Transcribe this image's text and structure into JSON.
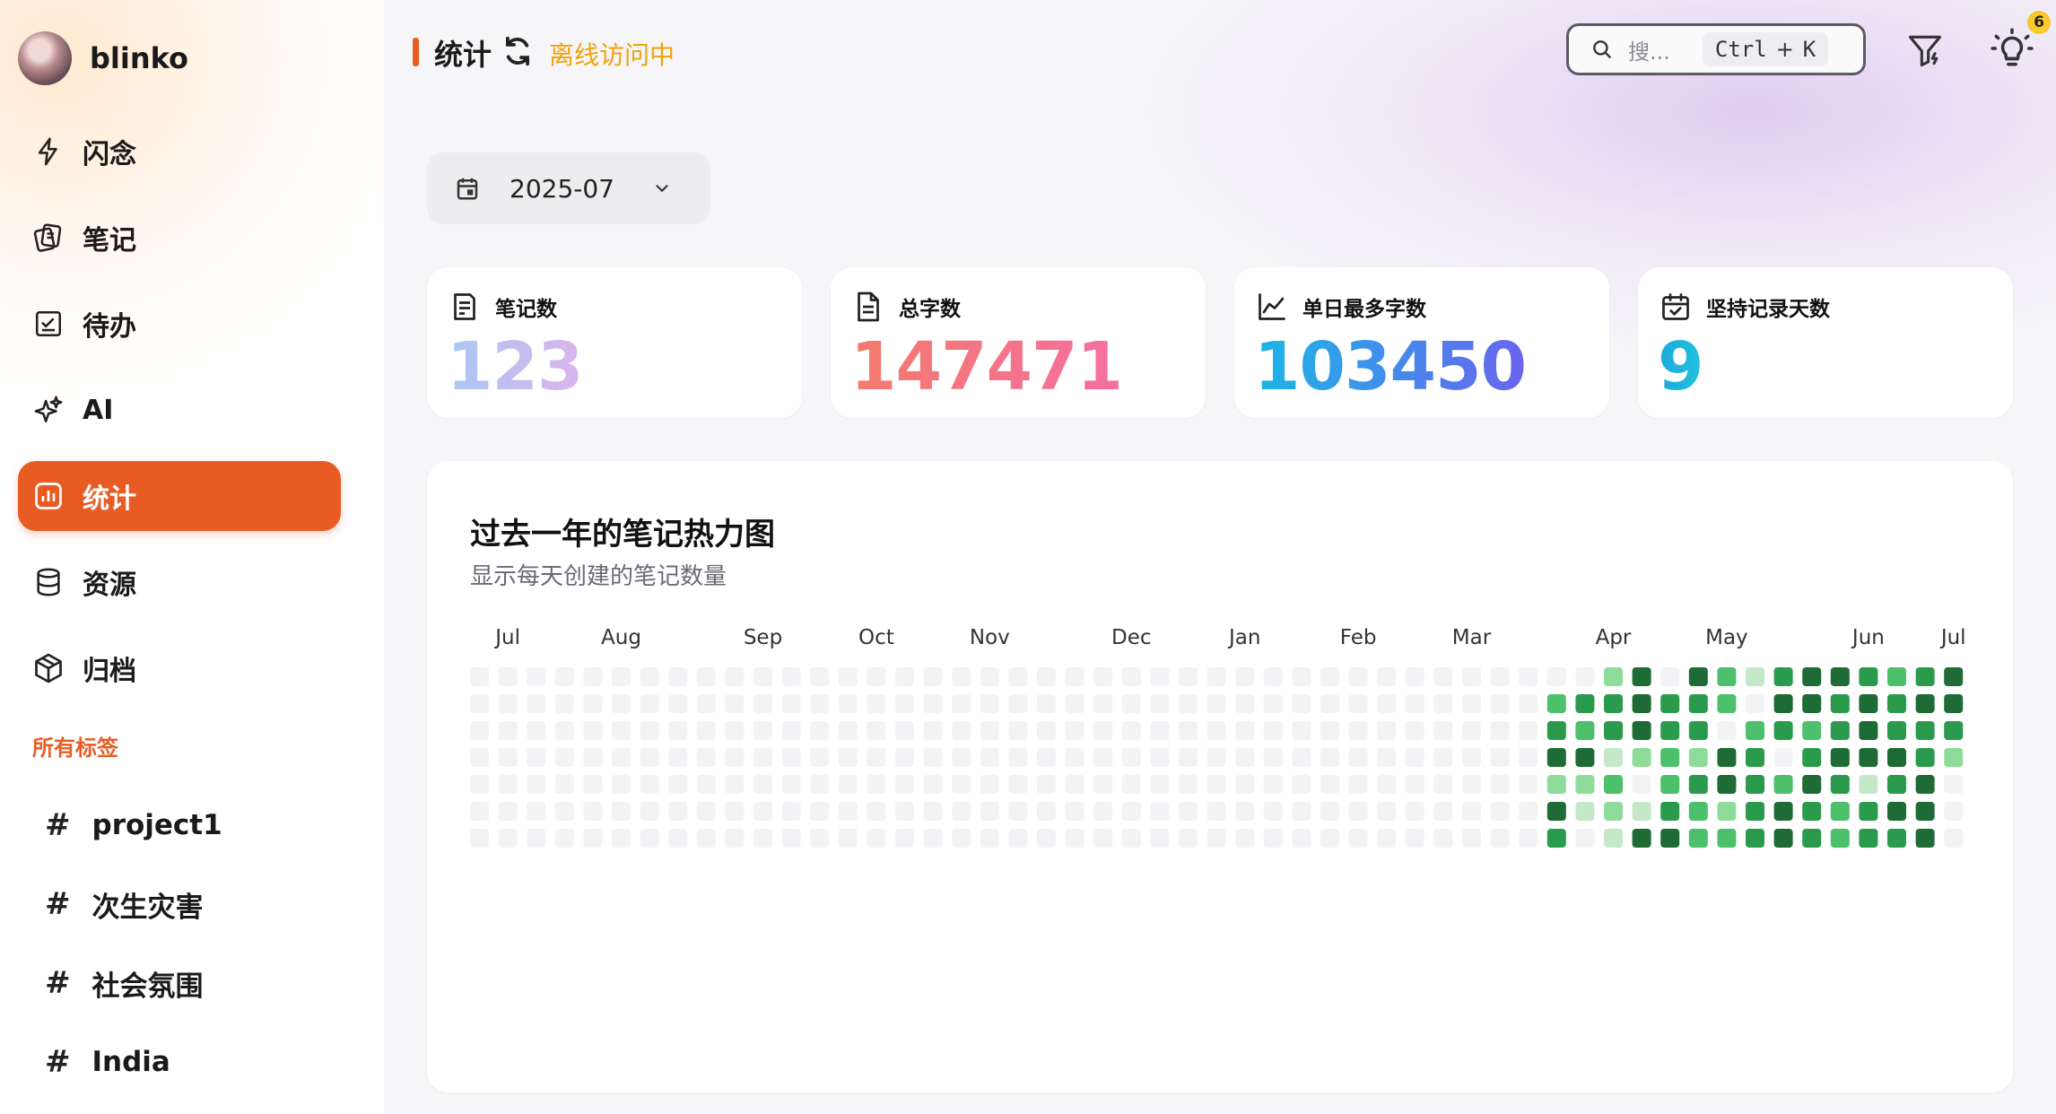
{
  "app": {
    "name": "blinko"
  },
  "sidebar": {
    "items": [
      {
        "label": "闪念",
        "icon": "lightning-icon"
      },
      {
        "label": "笔记",
        "icon": "notes-icon"
      },
      {
        "label": "待办",
        "icon": "todo-icon"
      },
      {
        "label": "AI",
        "icon": "sparkle-icon"
      },
      {
        "label": "统计",
        "icon": "chart-icon",
        "active": true
      },
      {
        "label": "资源",
        "icon": "database-icon"
      },
      {
        "label": "归档",
        "icon": "archive-box-icon"
      }
    ],
    "tags_title": "所有标签",
    "tags": [
      {
        "hash": "#",
        "label": "project1"
      },
      {
        "hash": "#",
        "label": "次生灾害"
      },
      {
        "hash": "#",
        "label": "社会氛围"
      },
      {
        "hash": "#",
        "label": "India"
      }
    ]
  },
  "header": {
    "title": "统计",
    "status": "离线访问中",
    "search_placeholder": "搜...",
    "shortcut_ctrl": "Ctrl",
    "shortcut_plus": "+",
    "shortcut_key": "K",
    "notification_count": "6"
  },
  "month_picker": {
    "value": "2025-07"
  },
  "stats": [
    {
      "label": "笔记数",
      "value": "123",
      "icon": "note-list-icon"
    },
    {
      "label": "总字数",
      "value": "147471",
      "icon": "document-icon"
    },
    {
      "label": "单日最多字数",
      "value": "103450",
      "icon": "line-chart-icon"
    },
    {
      "label": "坚持记录天数",
      "value": "9",
      "icon": "calendar-check-icon"
    }
  ],
  "heatmap": {
    "title": "过去一年的笔记热力图",
    "subtitle": "显示每天创建的笔记数量",
    "months": [
      {
        "label": "Jul",
        "week": 1
      },
      {
        "label": "Aug",
        "week": 5
      },
      {
        "label": "Sep",
        "week": 10
      },
      {
        "label": "Oct",
        "week": 14
      },
      {
        "label": "Nov",
        "week": 18
      },
      {
        "label": "Dec",
        "week": 23
      },
      {
        "label": "Jan",
        "week": 27
      },
      {
        "label": "Feb",
        "week": 31
      },
      {
        "label": "Mar",
        "week": 35
      },
      {
        "label": "Apr",
        "week": 40
      },
      {
        "label": "May",
        "week": 44
      },
      {
        "label": "Jun",
        "week": 49
      },
      {
        "label": "Jul",
        "week": 52
      }
    ],
    "colors": [
      "#f3f3f5",
      "#c5e8c9",
      "#8fdc9a",
      "#4cc06a",
      "#2a9a4d",
      "#1e6b35"
    ],
    "active_columns": [
      [
        "",
        "",
        "",
        "",
        "",
        "",
        ""
      ],
      [
        "",
        "",
        "",
        "",
        "",
        "",
        ""
      ],
      [
        "",
        "",
        "",
        "",
        "",
        "",
        ""
      ],
      [
        "",
        "",
        "",
        "",
        "",
        "",
        ""
      ],
      [
        "",
        "",
        "",
        "",
        "",
        "",
        ""
      ],
      [
        "",
        "",
        "",
        "",
        "",
        "",
        ""
      ],
      [
        "",
        "",
        "",
        "",
        "",
        "",
        ""
      ],
      [
        "",
        "",
        "",
        "",
        "",
        "",
        ""
      ],
      [
        "",
        "",
        "",
        "",
        "",
        "",
        ""
      ],
      [
        "",
        "",
        "",
        "",
        "",
        "",
        ""
      ],
      [
        "",
        "",
        "",
        "",
        "",
        "",
        ""
      ],
      [
        "",
        "",
        "",
        "",
        "",
        "",
        ""
      ],
      [
        "",
        "",
        "",
        "",
        "",
        "",
        ""
      ],
      [
        "",
        "",
        "",
        "",
        "",
        "",
        ""
      ],
      [
        "",
        "",
        "",
        "",
        "",
        "",
        ""
      ],
      [
        "",
        "",
        "",
        "",
        "",
        "",
        ""
      ],
      [
        "",
        "",
        "",
        "",
        "",
        "",
        ""
      ],
      [
        "",
        "",
        "",
        "",
        "",
        "",
        ""
      ],
      [
        "",
        "",
        "",
        "",
        "",
        "",
        ""
      ],
      [
        "",
        "",
        "",
        "",
        "",
        "",
        ""
      ],
      [
        "",
        "",
        "",
        "",
        "",
        "",
        ""
      ],
      [
        "",
        "",
        "",
        "",
        "",
        "",
        ""
      ],
      [
        "",
        "",
        "",
        "",
        "",
        "",
        ""
      ],
      [
        "",
        "",
        "",
        "",
        "",
        "",
        ""
      ],
      [
        "",
        "",
        "",
        "",
        "",
        "",
        ""
      ],
      [
        "",
        "",
        "",
        "",
        "",
        "",
        ""
      ],
      [
        "",
        "",
        "",
        "",
        "",
        "",
        ""
      ],
      [
        "",
        "",
        "",
        "",
        "",
        "",
        ""
      ],
      [
        "",
        "",
        "",
        "",
        "",
        "",
        ""
      ],
      [
        "",
        "",
        "",
        "",
        "",
        "",
        ""
      ],
      [
        "",
        "",
        "",
        "",
        "",
        "",
        ""
      ],
      [
        "",
        "",
        "",
        "",
        "",
        "",
        ""
      ],
      [
        "",
        "",
        "",
        "",
        "",
        "",
        ""
      ],
      [
        "",
        "",
        "",
        "",
        "",
        "",
        ""
      ],
      [
        "",
        "",
        "",
        "",
        "",
        "",
        ""
      ],
      [
        "",
        "",
        "",
        "",
        "",
        "",
        ""
      ],
      [
        0,
        0,
        0,
        0,
        0,
        0,
        0
      ],
      [
        0,
        0,
        0,
        0,
        0,
        0,
        0
      ],
      [
        0,
        3,
        4,
        5,
        2,
        5,
        4
      ],
      [
        0,
        4,
        3,
        5,
        2,
        1,
        0
      ],
      [
        2,
        4,
        4,
        1,
        3,
        2,
        1
      ],
      [
        5,
        5,
        5,
        2,
        0,
        1,
        5
      ],
      [
        0,
        4,
        4,
        3,
        3,
        4,
        5
      ],
      [
        5,
        4,
        4,
        2,
        4,
        3,
        3
      ],
      [
        3,
        3,
        0,
        5,
        5,
        2,
        3
      ],
      [
        1,
        0,
        3,
        4,
        4,
        4,
        4
      ],
      [
        4,
        5,
        4,
        0,
        3,
        5,
        5
      ],
      [
        5,
        5,
        3,
        4,
        5,
        4,
        4
      ],
      [
        5,
        4,
        4,
        5,
        4,
        3,
        3
      ],
      [
        4,
        5,
        5,
        5,
        1,
        4,
        4
      ],
      [
        3,
        4,
        4,
        5,
        4,
        5,
        4
      ],
      [
        4,
        5,
        4,
        4,
        5,
        5,
        5
      ],
      [
        5,
        5,
        4,
        2,
        "",
        "",
        ""
      ]
    ]
  }
}
